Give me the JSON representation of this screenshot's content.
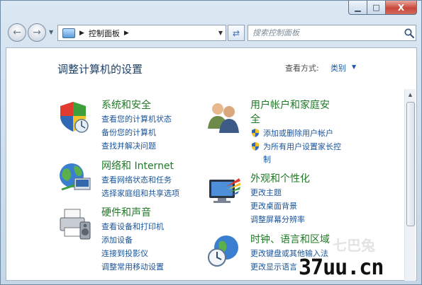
{
  "window": {
    "minimize": "▁",
    "maximize": "□",
    "close": "X"
  },
  "nav": {
    "back_glyph": "←",
    "forward_glyph": "→",
    "address_crumb": "控制面板",
    "refresh_glyph": "⇄",
    "search_placeholder": "搜索控制面板"
  },
  "header": {
    "title": "调整计算机的设置",
    "view_by_label": "查看方式:",
    "view_by_value": "类别"
  },
  "categories": [
    {
      "title": "系统和安全",
      "links": [
        "查看您的计算机状态",
        "备份您的计算机",
        "查找并解决问题"
      ]
    },
    {
      "title": "网络和 Internet",
      "links": [
        "查看网络状态和任务",
        "选择家庭组和共享选项"
      ]
    },
    {
      "title": "硬件和声音",
      "links": [
        "查看设备和打印机",
        "添加设备",
        "连接到投影仪",
        "调整常用移动设置"
      ]
    },
    {
      "title_line1": "用户帐户和家庭安",
      "title_line2": "全",
      "links": [
        "添加或删除用户帐户",
        "为所有用户设置家长控",
        "制"
      ]
    },
    {
      "title": "外观和个性化",
      "links": [
        "更改主题",
        "更改桌面背景",
        "调整屏幕分辨率"
      ]
    },
    {
      "title": "时钟、语言和区域",
      "links": [
        "更改键盘或其他输入法",
        "更改显示语言"
      ]
    }
  ],
  "watermark": {
    "logo": "七巴兔",
    "url": "37uu.cn"
  },
  "colors": {
    "title": "#1e3f66",
    "category": "#1f7a26",
    "link": "#1a5499"
  }
}
